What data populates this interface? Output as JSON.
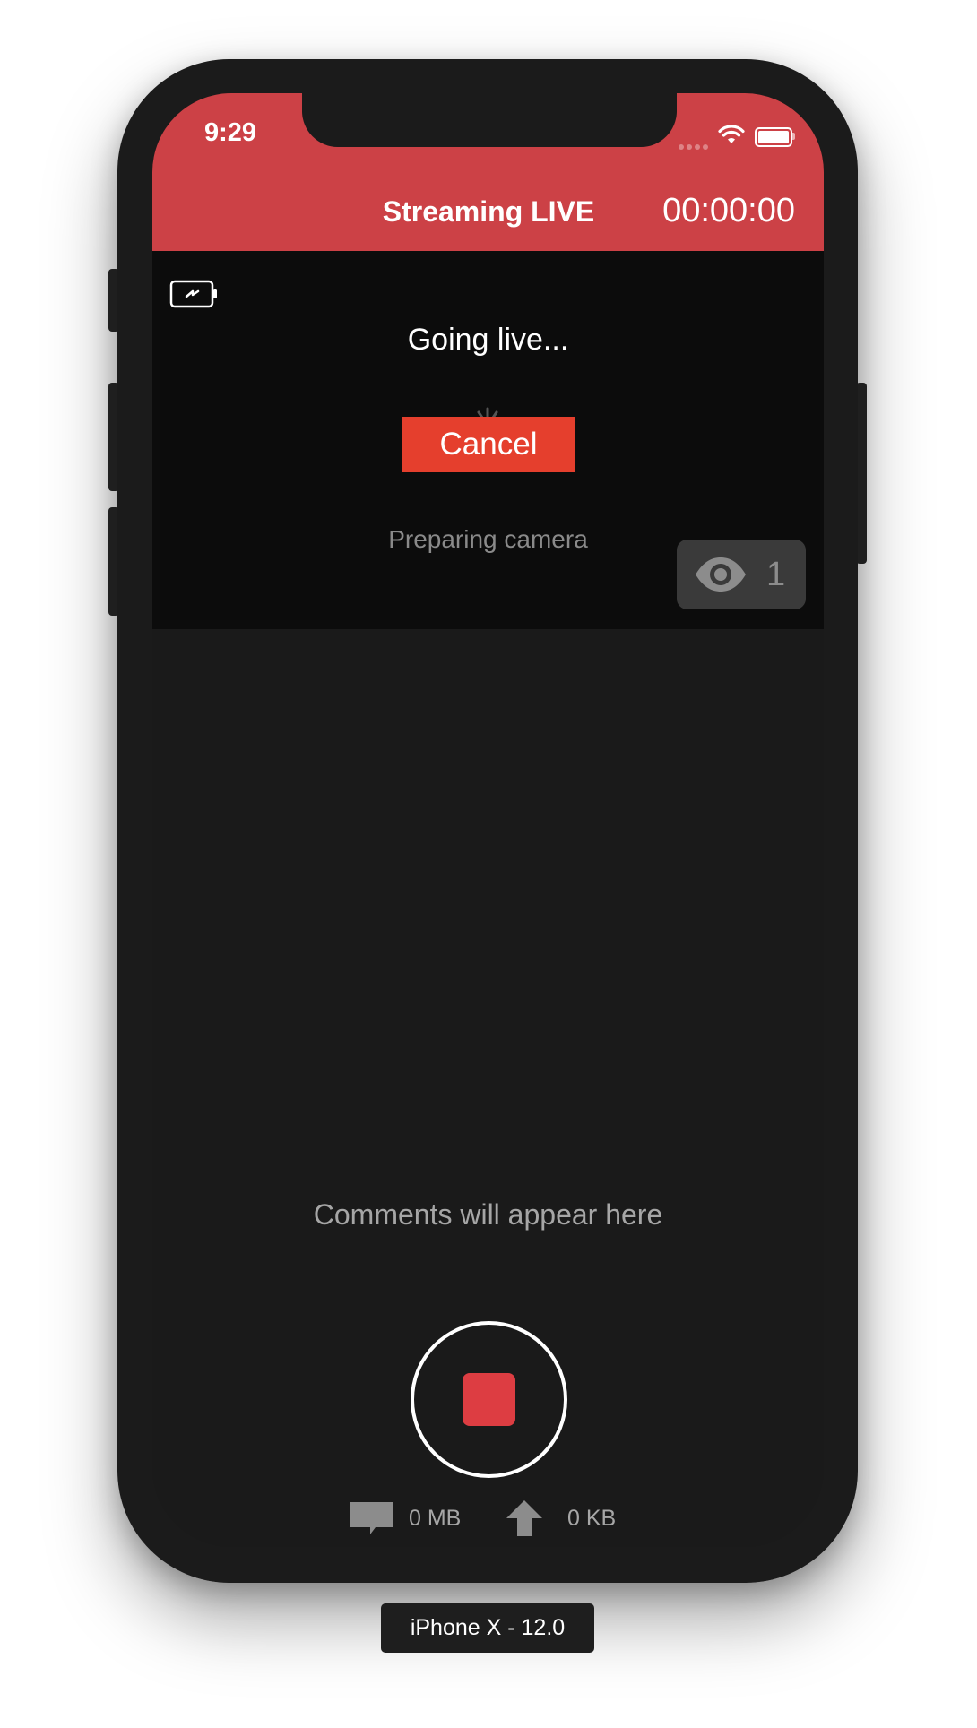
{
  "status_bar": {
    "time": "9:29",
    "icons": [
      "signal-icon",
      "wifi-icon",
      "battery-icon"
    ]
  },
  "nav": {
    "title": "Streaming LIVE",
    "timer": "00:00:00",
    "background_color": "#cc4146"
  },
  "preview": {
    "charging_icon": "battery-charging-icon",
    "status": "Going live...",
    "cancel_label": "Cancel",
    "cancel_color": "#e53f2d",
    "subtitle": "Preparing camera",
    "viewer_icon": "eye-icon",
    "viewer_count": "1"
  },
  "comments_placeholder": "Comments will appear here",
  "record": {
    "icon": "stop-icon",
    "stop_color": "#dd3d42"
  },
  "stats": {
    "storage_icon": "sd-card-icon",
    "storage_value": "0 MB",
    "upload_icon": "upload-arrow-icon",
    "upload_value": "0 KB"
  },
  "device_label": "iPhone X - 12.0"
}
